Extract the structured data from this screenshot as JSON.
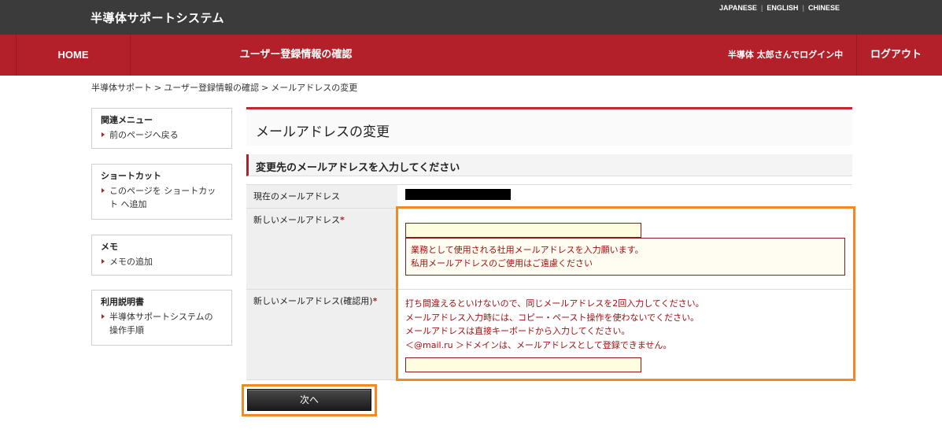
{
  "header": {
    "site_title": "半導体サポートシステム",
    "languages": [
      "JAPANESE",
      "ENGLISH",
      "CHINESE"
    ]
  },
  "nav": {
    "home": "HOME",
    "current": "ユーザー登録情報の確認",
    "user_status": "半導体 太郎さんでログイン中",
    "logout": "ログアウト"
  },
  "breadcrumb": {
    "items": [
      "半導体サポート",
      "ユーザー登録情報の確認",
      "メールアドレスの変更"
    ],
    "separator": ">"
  },
  "sidebar": {
    "related": {
      "heading": "関連メニュー",
      "links": [
        "前のページへ戻る"
      ]
    },
    "shortcut": {
      "heading": "ショートカット",
      "links": [
        "このページを ショートカット へ追加"
      ]
    },
    "memo": {
      "heading": "メモ",
      "links": [
        "メモの追加"
      ]
    },
    "manual": {
      "heading": "利用説明書",
      "links": [
        "半導体サポートシステムの 操作手順"
      ]
    }
  },
  "main": {
    "page_title": "メールアドレスの変更",
    "section_heading": "変更先のメールアドレスを入力してください",
    "rows": {
      "current_email": {
        "label": "現在のメールアドレス"
      },
      "new_email": {
        "label": "新しいメールアドレス",
        "required_mark": "*",
        "value": "",
        "hint_lines": [
          "業務として使用される社用メールアドレスを入力願います。",
          "私用メールアドレスのご使用はご遠慮ください"
        ]
      },
      "confirm_email": {
        "label": "新しいメールアドレス(確認用)",
        "required_mark": "*",
        "value": "",
        "notes": [
          "打ち間違えるといけないので、同じメールアドレスを2回入力してください。",
          "メールアドレス入力時には、コピー・ペースト操作を使わないでください。",
          "メールアドレスは直接キーボードから入力してください。",
          "＜@mail.ru ＞ドメインは、メールアドレスとして登録できません。"
        ]
      }
    },
    "next_button": "次へ"
  },
  "colors": {
    "nav_red": "#b3202a",
    "topbar": "#3b3b3b",
    "highlight_orange": "#f08a24",
    "input_bg": "#fffde0",
    "note_red": "#a01010"
  }
}
